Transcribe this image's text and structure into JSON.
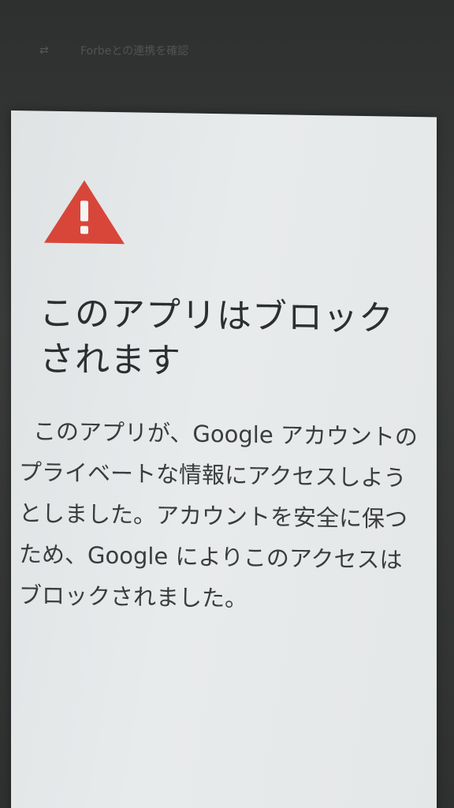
{
  "background": {
    "text": "Forbeとの連携を確認"
  },
  "dialog": {
    "title": "このアプリはブロックされます",
    "message": "このアプリが、Google アカウントのプライベートな情報にアクセスしようとしました。アカウントを安全に保つため、Google によりこのアクセスはブロックされました。"
  },
  "colors": {
    "warning": "#d8463a",
    "dialog_bg": "#e5e8e9",
    "text": "#2c2e2f"
  }
}
